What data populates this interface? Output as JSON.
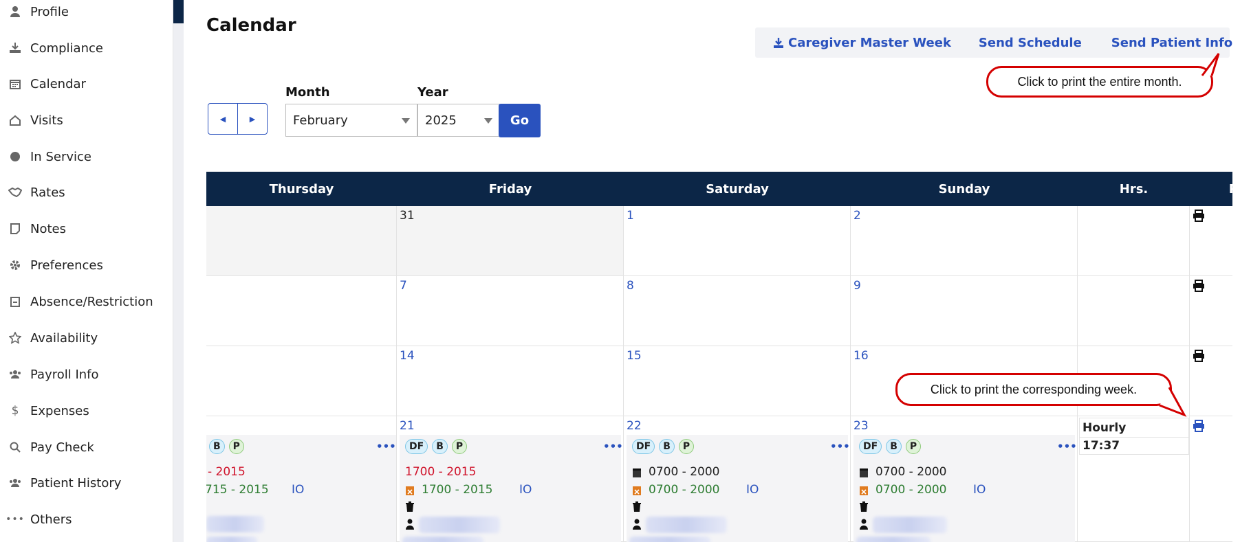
{
  "sidebar": {
    "items": [
      {
        "label": "Profile",
        "icon": "user-icon"
      },
      {
        "label": "Compliance",
        "icon": "compliance-icon"
      },
      {
        "label": "Calendar",
        "icon": "calendar-icon"
      },
      {
        "label": "Visits",
        "icon": "house-icon"
      },
      {
        "label": "In Service",
        "icon": "circle-icon"
      },
      {
        "label": "Rates",
        "icon": "handshake-icon"
      },
      {
        "label": "Notes",
        "icon": "note-icon"
      },
      {
        "label": "Preferences",
        "icon": "gear-icon"
      },
      {
        "label": "Absence/Restriction",
        "icon": "calendar-minus-icon"
      },
      {
        "label": "Availability",
        "icon": "star-icon"
      },
      {
        "label": "Payroll Info",
        "icon": "users-icon"
      },
      {
        "label": "Expenses",
        "icon": "dollar-icon"
      },
      {
        "label": "Pay Check",
        "icon": "search-dollar-icon"
      },
      {
        "label": "Patient History",
        "icon": "users-icon"
      },
      {
        "label": "Others",
        "icon": "ellipsis-icon"
      }
    ]
  },
  "page": {
    "title": "Calendar"
  },
  "toolbar": {
    "caregiver_master_week": "Caregiver Master Week",
    "send_schedule": "Send Schedule",
    "send_patient_info": "Send Patient Info"
  },
  "callouts": {
    "print_month": "Click to print the entire month.",
    "print_week": "Click to print the corresponding week."
  },
  "controls": {
    "month_label": "Month",
    "month_value": "February",
    "year_label": "Year",
    "year_value": "2025",
    "go_label": "Go"
  },
  "calendar": {
    "headers": [
      "Thursday",
      "Friday",
      "Saturday",
      "Sunday",
      "Hrs.",
      "P"
    ],
    "weeks": [
      {
        "days": [
          "",
          "31",
          "1",
          "2"
        ]
      },
      {
        "days": [
          "",
          "7",
          "8",
          "9"
        ]
      },
      {
        "days": [
          "",
          "14",
          "15",
          "16"
        ]
      },
      {
        "days": [
          "",
          "21",
          "22",
          "23"
        ]
      }
    ],
    "last_week": {
      "badges": {
        "df": "DF",
        "b": "B",
        "p": "P"
      },
      "more": "•••",
      "thursday": {
        "time1": "- 2015",
        "time2": "715 - 2015",
        "io": "IO"
      },
      "friday": {
        "time1": "1700 - 2015",
        "time2": "1700 - 2015",
        "io": "IO"
      },
      "saturday": {
        "time1": "0700 - 2000",
        "time2": "0700 - 2000",
        "io": "IO"
      },
      "sunday": {
        "time1": "0700 - 2000",
        "time2": "0700 - 2000",
        "io": "IO"
      },
      "hours_label": "Hourly",
      "hours_value": "17:37"
    }
  },
  "colors": {
    "navy": "#0c2647",
    "accent": "#2a52be",
    "alert": "#d40000"
  }
}
